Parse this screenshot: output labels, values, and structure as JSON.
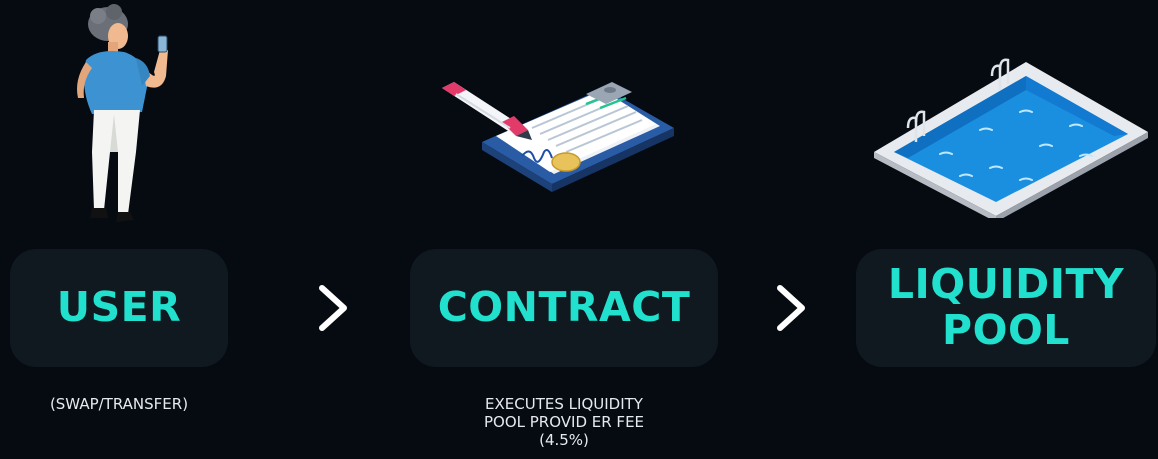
{
  "steps": [
    {
      "label": "USER",
      "caption": "(SWAP/TRANSFER)",
      "illustration": "person-with-phone-icon"
    },
    {
      "label": "CONTRACT",
      "caption_lines": [
        "EXECUTES LIQUIDITY",
        "POOL PROVID ER FEE",
        "(4.5%)"
      ],
      "illustration": "clipboard-contract-icon"
    },
    {
      "label_lines": [
        "LIQUIDITY",
        "POOL"
      ],
      "illustration": "swimming-pool-icon"
    }
  ],
  "arrow_icon": "chevron-right-icon",
  "colors": {
    "background": "#060b12",
    "card": "#101820",
    "accent": "#21e0cd",
    "caption": "#e6e9ee"
  }
}
